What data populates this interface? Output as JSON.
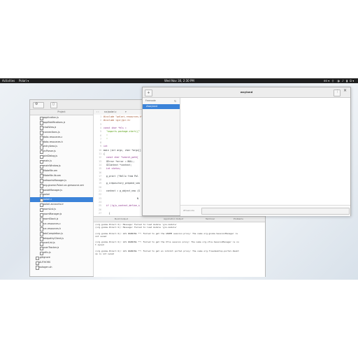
{
  "topbar": {
    "activities": "Activities",
    "app_menu": "Polari ▾",
    "clock": "Wed Nov 30, 2:30 PM",
    "tray": [
      "en ▾",
      "⏚",
      "◑",
      "♪",
      "▮",
      "⏻ ▾"
    ]
  },
  "editor": {
    "panel_title": "Project",
    "tab_label": "src/polari.c",
    "tab_prefix": "‹ ›",
    "project_items": [
      "application.js",
      "applNotifications.js",
      "chatView.js",
      "connections.js",
      "data-resources.c",
      "data-resources.h",
      "entryArea.js",
      "ircParser.js",
      "joinDialog.js",
      "main.js",
      "mainWindow.js",
      "Makefile.am",
      "Makefile.lib.am",
      "networksManager.js",
      "org.gnome.Polari.src.gresource.xml",
      "pasteManager.js",
      "polari",
      "polari.c",
      "polari-accounts.in",
      "roomList.js",
      "roomManager.js",
      "roomStack.js",
      "src-resources.c",
      "src-resources.h",
      "tabCompletion.js",
      "telepathyClient.js",
      "userList.js",
      "userTracker.js",
      "utils.js",
      ".gitignore",
      "AUTHORS",
      "autogen.sh"
    ],
    "selected_item": "polari.c",
    "code_lines": [
      {
        "n": "",
        "t": "#include \"polari-resources.h\""
      },
      {
        "n": "",
        "t": "#include <gir/gir.h>"
      },
      {
        "n": "",
        "t": ""
      },
      {
        "n": "",
        "t": "const char *els ="
      },
      {
        "n": "",
        "t": "  \"imports.package.start({\""
      },
      {
        "n": "",
        "t": "  \""
      },
      {
        "n": "",
        "t": "  \""
      },
      {
        "n": "",
        "t": ""
      },
      {
        "n": "",
        "t": "int"
      },
      {
        "n": "",
        "t": "main (int argc, char *argv[]"
      },
      {
        "n": "",
        "t": "{"
      },
      {
        "n": "",
        "t": "  const char *search_path["
      },
      {
        "n": "",
        "t": "  GError *error = NULL;"
      },
      {
        "n": "",
        "t": "  GIContext *context;"
      },
      {
        "n": "",
        "t": "  int status;"
      },
      {
        "n": "",
        "t": ""
      },
      {
        "n": "",
        "t": "  g_print (\"Hello from Pol"
      },
      {
        "n": "",
        "t": ""
      },
      {
        "n": "",
        "t": "  g_irepository_prepend_sea"
      },
      {
        "n": "",
        "t": ""
      },
      {
        "n": "",
        "t": "  context = g_object_new (G"
      },
      {
        "n": "",
        "t": ""
      },
      {
        "n": "",
        "t": "                         N"
      },
      {
        "n": "",
        "t": ""
      },
      {
        "n": "",
        "t": "  if (!gjs_context_define_s"
      },
      {
        "n": "",
        "t": ""
      },
      {
        "n": "",
        "t": "    {"
      }
    ],
    "line_numbers": [
      "1",
      "2",
      "3",
      "4",
      "5",
      "6",
      "7",
      "8",
      "9",
      "10",
      "11",
      "12",
      "13",
      "14",
      "15",
      "16",
      "17",
      "18",
      "19",
      "20",
      "21",
      "22",
      "23",
      "24",
      "25",
      "26",
      "27"
    ],
    "console_tabs": [
      "Build Output",
      "Application Output",
      "Terminal",
      "Problems"
    ],
    "console_lines": [
      "(org.gnome.Polari:2): Message: Failed to load module 'gio-module'",
      "(org.gnome.Polari:2): Message: Failed to load module 'gio-module'",
      "",
      "(org.gnome.Polari:2): GJS WARNING **: Failed to get the GNOME session proxy: The name org.gnome.SessionManager is",
      "not owned",
      "",
      "(org.gnome.Polari:2): GJS WARNING **: Failed to get the Xfce session proxy: The name org.xfce.SessionManager is no",
      "t owned",
      "",
      "(org.gnome.Polari:2): GJS WARNING **: Failed to get an inhibit portal proxy: The name org.freedesktop.portal.Deskt",
      "op is not owned"
    ]
  },
  "wayland": {
    "title": "wayland",
    "side_title": "Freenode",
    "room_selected": "#wayland",
    "entry_placeholder": "#freenode"
  },
  "colors": {
    "accent": "#3b83d9",
    "topbar": "#1f1f1f",
    "keyword": "#8a2f8a",
    "string": "#4e9a06",
    "preproc": "#a0522d"
  }
}
